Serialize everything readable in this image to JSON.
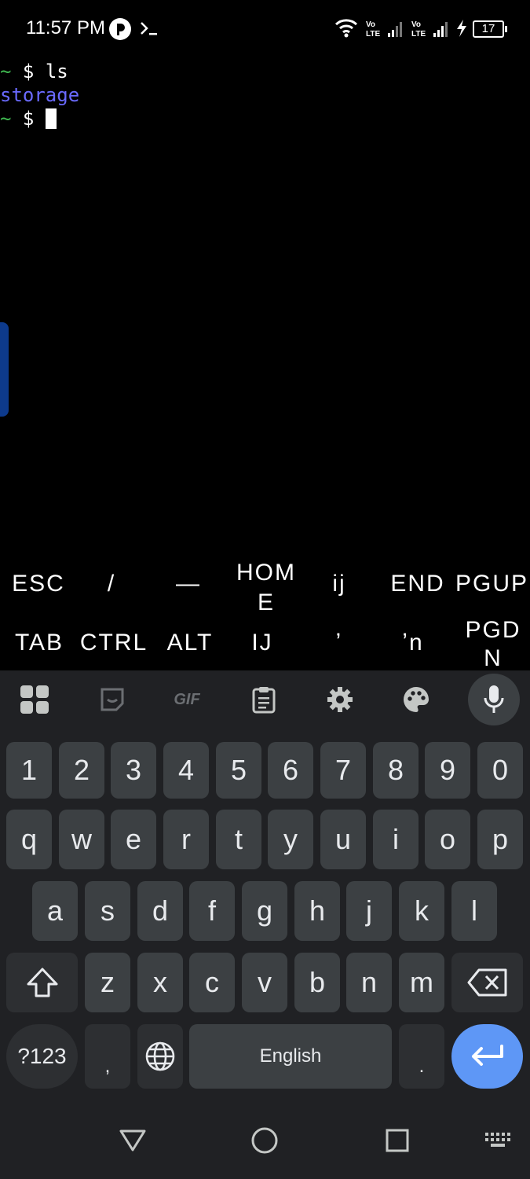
{
  "status_bar": {
    "time": "11:57 PM",
    "battery": "17"
  },
  "terminal": {
    "lines": [
      {
        "prompt": "~ $ ",
        "command": "ls"
      },
      {
        "output": "storage"
      },
      {
        "prompt": "~ $ ",
        "command": ""
      }
    ],
    "colors": {
      "tilde": "#3fb950",
      "directory": "#6a6aff"
    }
  },
  "extra_keys": {
    "row1": [
      "ESC",
      "/",
      "—",
      "HOME",
      "ij",
      "END",
      "PGUP"
    ],
    "row2": [
      "TAB",
      "CTRL",
      "ALT",
      "IJ",
      "ʼ",
      "ʼn",
      "PGDN"
    ]
  },
  "keyboard": {
    "toolbar_icons": [
      "apps-grid-icon",
      "sticker-icon",
      "gif-icon",
      "clipboard-icon",
      "settings-gear-icon",
      "palette-icon",
      "microphone-icon"
    ],
    "toolbar_gif_label": "GIF",
    "numbers": [
      "1",
      "2",
      "3",
      "4",
      "5",
      "6",
      "7",
      "8",
      "9",
      "0"
    ],
    "row_q": [
      "q",
      "w",
      "e",
      "r",
      "t",
      "y",
      "u",
      "i",
      "o",
      "p"
    ],
    "row_a": [
      "a",
      "s",
      "d",
      "f",
      "g",
      "h",
      "j",
      "k",
      "l"
    ],
    "row_z": [
      "z",
      "x",
      "c",
      "v",
      "b",
      "n",
      "m"
    ],
    "symbols_key": "?123",
    "comma_key": ",",
    "space_label": "English",
    "period_key": ".",
    "accent_color": "#5e97f6"
  },
  "nav_bar": {
    "icons": [
      "back-icon",
      "home-icon",
      "recents-icon",
      "keyboard-switch-icon"
    ]
  }
}
